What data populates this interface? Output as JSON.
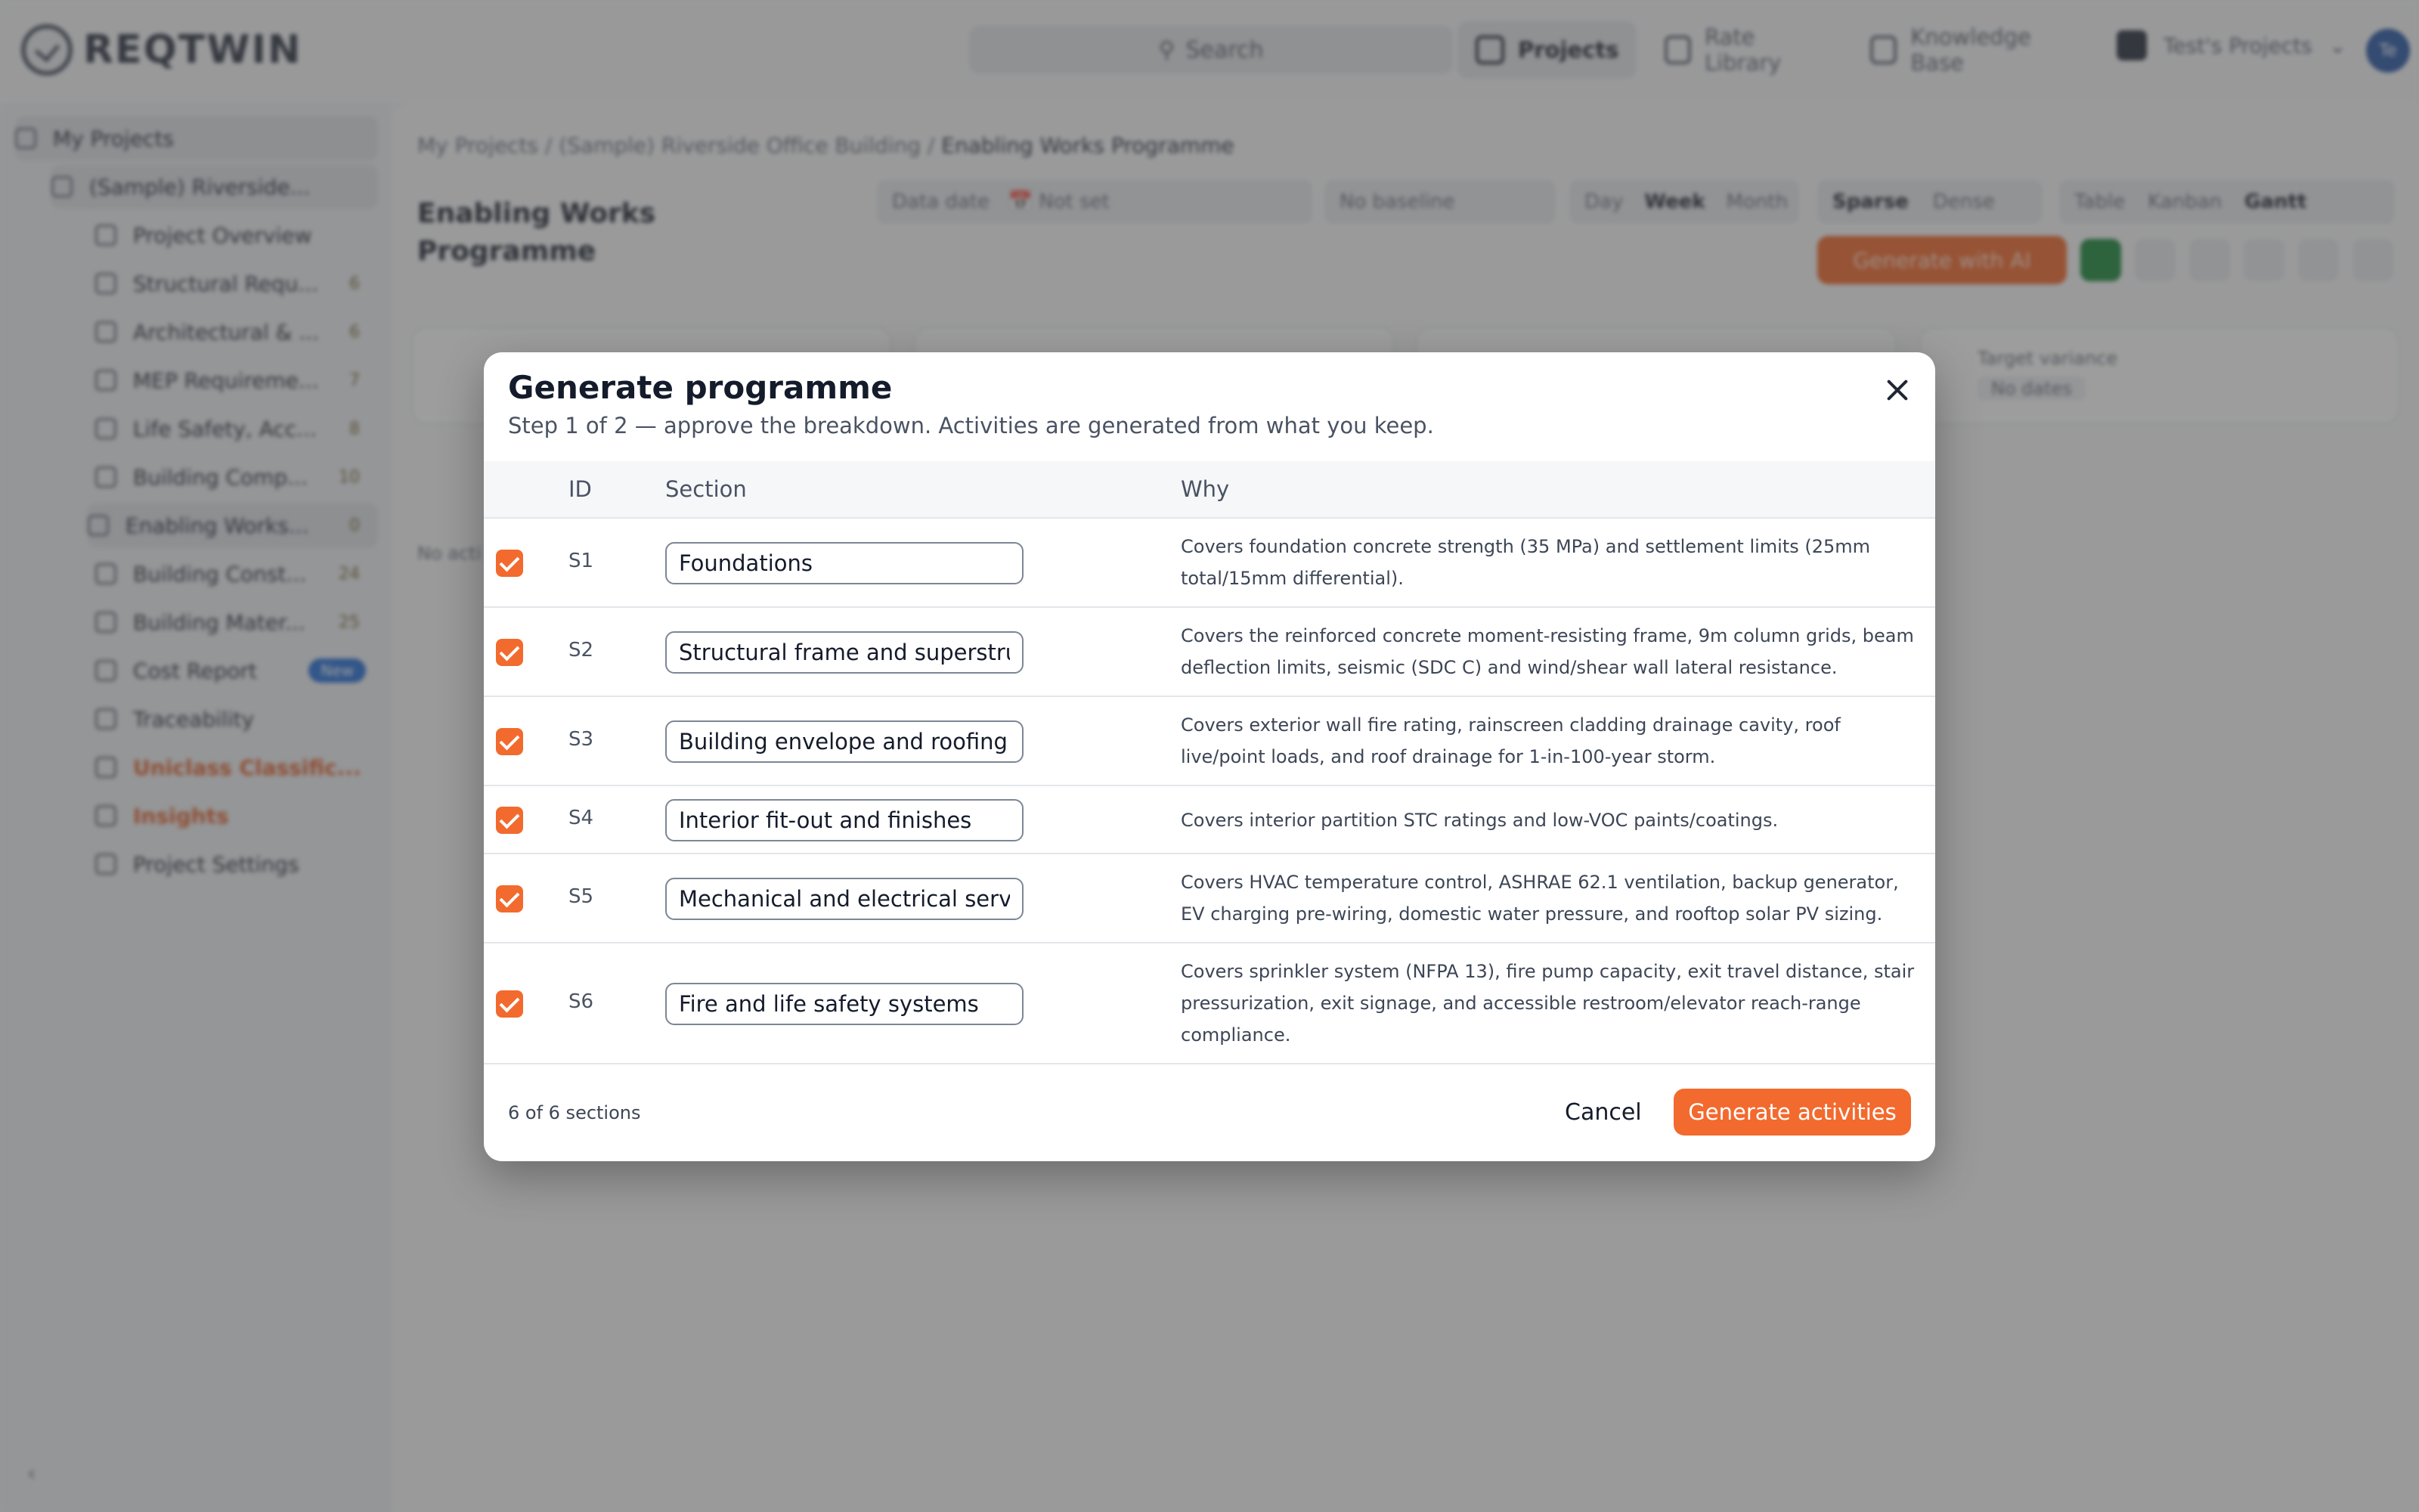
{
  "app": {
    "logo_text": "REQTWIN",
    "search_label": "Search",
    "nav": [
      {
        "label": "Projects"
      },
      {
        "label": "Rate Library"
      },
      {
        "label": "Knowledge Base"
      }
    ],
    "project_switch": "Test's Projects",
    "avatar_initials": "Te"
  },
  "sidebar": {
    "items": [
      {
        "label": "My Projects",
        "count": ""
      },
      {
        "label": "(Sample) Riverside...",
        "count": ""
      },
      {
        "label": "Project Overview",
        "count": ""
      },
      {
        "label": "Structural Requ...",
        "count": "6"
      },
      {
        "label": "Architectural & ...",
        "count": "6"
      },
      {
        "label": "MEP Requireme...",
        "count": "7"
      },
      {
        "label": "Life Safety, Acc...",
        "count": "8"
      },
      {
        "label": "Building Comp...",
        "count": "10"
      },
      {
        "label": "Enabling Works...",
        "count": "0"
      },
      {
        "label": "Building Const...",
        "count": "24"
      },
      {
        "label": "Building Mater...",
        "count": "25"
      },
      {
        "label": "Cost Report",
        "count": "New"
      },
      {
        "label": "Traceability",
        "count": ""
      },
      {
        "label": "Uniclass Classific...",
        "count": ""
      },
      {
        "label": "Insights",
        "count": ""
      },
      {
        "label": "Project Settings",
        "count": ""
      }
    ]
  },
  "page": {
    "breadcrumb_prefix": "My Projects / (Sample) Riverside Office Building / ",
    "breadcrumb_current": "Enabling Works Programme",
    "title": "Enabling Works Programme",
    "data_date_label": "Data date",
    "data_date_value": "Not set",
    "baseline": "No baseline",
    "views": [
      "Day",
      "Week",
      "Month"
    ],
    "density": [
      "Sparse",
      "Dense"
    ],
    "layouts": [
      "Table",
      "Kanban",
      "Gantt"
    ],
    "generate_ai": "Generate with AI",
    "target_variance_label": "Target variance",
    "target_variance_value": "No dates",
    "no_activities": "No acti"
  },
  "modal": {
    "title": "Generate programme",
    "subtitle": "Step 1 of 2 — approve the breakdown. Activities are generated from what you keep.",
    "columns": {
      "id": "ID",
      "section": "Section",
      "why": "Why"
    },
    "rows": [
      {
        "id": "S1",
        "section": "Foundations",
        "checked": true,
        "why": "Covers foundation concrete strength (35 MPa) and settlement limits (25mm total/15mm differential)."
      },
      {
        "id": "S2",
        "section": "Structural frame and superstructure",
        "checked": true,
        "why": "Covers the reinforced concrete moment-resisting frame, 9m column grids, beam deflection limits, seismic (SDC C) and wind/shear wall lateral resistance."
      },
      {
        "id": "S3",
        "section": "Building envelope and roofing",
        "checked": true,
        "why": "Covers exterior wall fire rating, rainscreen cladding drainage cavity, roof live/point loads, and roof drainage for 1-in-100-year storm."
      },
      {
        "id": "S4",
        "section": "Interior fit-out and finishes",
        "checked": true,
        "why": "Covers interior partition STC ratings and low-VOC paints/coatings."
      },
      {
        "id": "S5",
        "section": "Mechanical and electrical services",
        "checked": true,
        "why": "Covers HVAC temperature control, ASHRAE 62.1 ventilation, backup generator, EV charging pre-wiring, domestic water pressure, and rooftop solar PV sizing."
      },
      {
        "id": "S6",
        "section": "Fire and life safety systems",
        "checked": true,
        "why": "Covers sprinkler system (NFPA 13), fire pump capacity, exit travel distance, stair pressurization, exit signage, and accessible restroom/elevator reach-range compliance."
      }
    ],
    "footer_count": "6 of 6 sections",
    "cancel_label": "Cancel",
    "generate_label": "Generate activities"
  },
  "colors": {
    "accent": "#f26a2e",
    "text": "#141b2b",
    "badge_blue": "#2a72d8"
  }
}
